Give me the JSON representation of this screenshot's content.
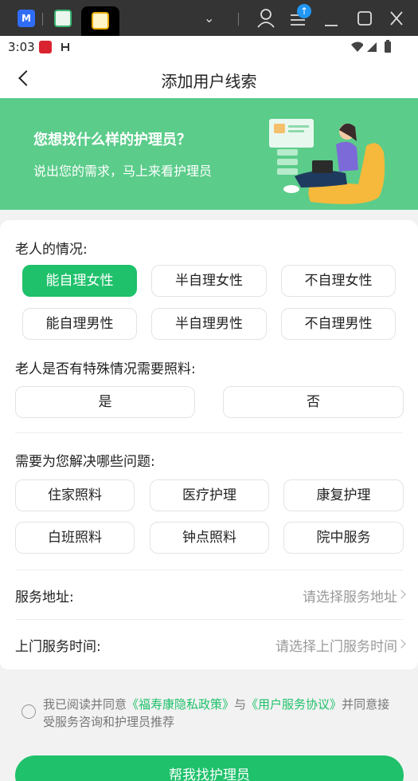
{
  "system_bar": {
    "app1_label": "M",
    "upload_badge": "↑"
  },
  "status_bar": {
    "time": "3:03"
  },
  "header": {
    "title": "添加用户线索"
  },
  "banner": {
    "title": "您想找什么样的护理员？",
    "subtitle": "说出您的需求，马上来看护理员"
  },
  "elder_condition": {
    "label": "老人的情况:",
    "options": [
      "能自理女性",
      "半自理女性",
      "不自理女性",
      "能自理男性",
      "半自理男性",
      "不自理男性"
    ],
    "selected": "能自理女性"
  },
  "special_care": {
    "label": "老人是否有特殊情况需要照料:",
    "options": [
      "是",
      "否"
    ]
  },
  "problems": {
    "label": "需要为您解决哪些问题:",
    "options": [
      "住家照料",
      "医疗护理",
      "康复护理",
      "白班照料",
      "钟点照料",
      "院中服务"
    ]
  },
  "address": {
    "label": "服务地址:",
    "placeholder": "请选择服务地址"
  },
  "service_time": {
    "label": "上门服务时间:",
    "placeholder": "请选择上门服务时间"
  },
  "agreement": {
    "prefix": "我已阅读并同意",
    "privacy_link": "《福寿康隐私政策》",
    "and": "与",
    "service_link": "《用户服务协议》",
    "suffix": "并同意接受服务咨询和护理员推荐"
  },
  "submit_label": "帮我找护理员",
  "colors": {
    "accent": "#1fc16b",
    "banner": "#5bcc8a"
  }
}
